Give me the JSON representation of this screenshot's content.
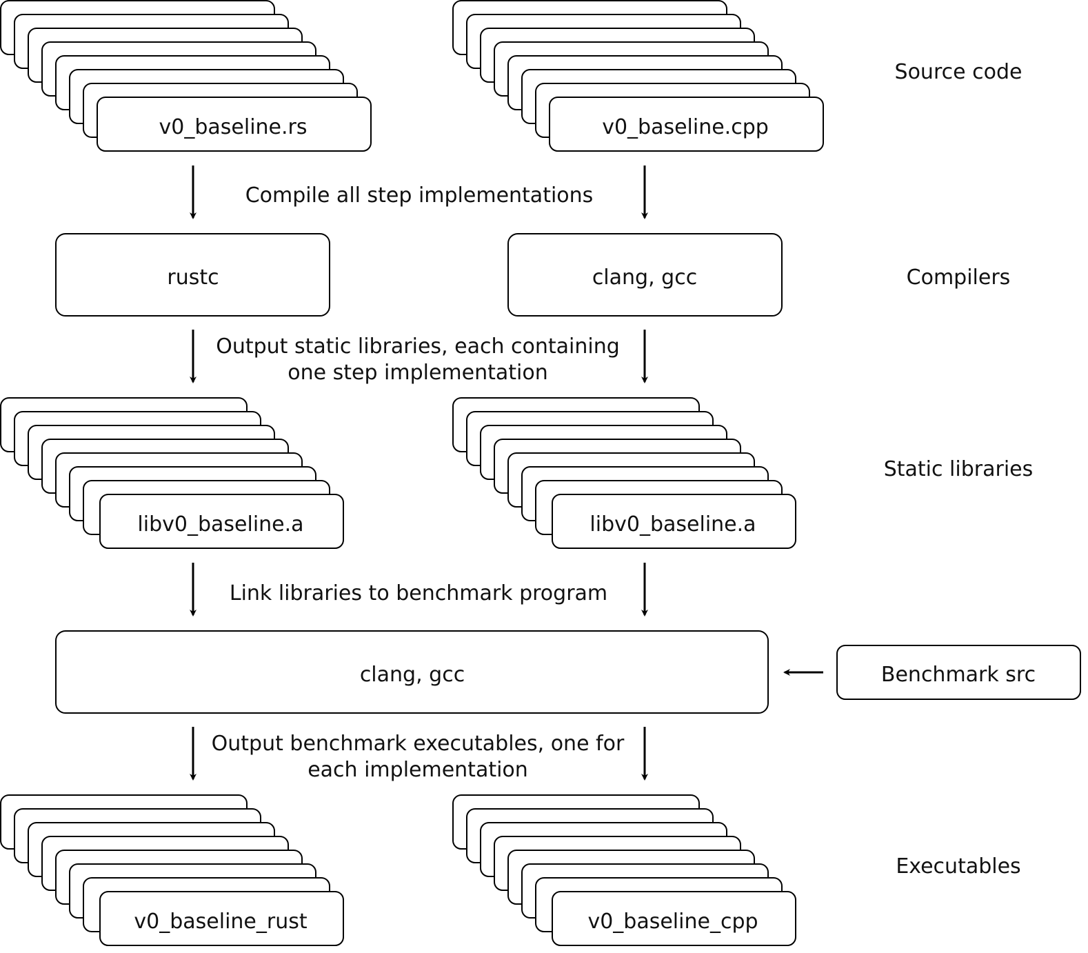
{
  "stages": {
    "source": "Source code",
    "compilers": "Compilers",
    "static_libs": "Static libraries",
    "executables": "Executables"
  },
  "rust": {
    "source_file": "v0_baseline.rs",
    "compiler": "rustc",
    "library": "libv0_baseline.a",
    "executable": "v0_baseline_rust"
  },
  "cpp": {
    "source_file": "v0_baseline.cpp",
    "compiler": "clang, gcc",
    "library": "libv0_baseline.a",
    "executable": "v0_baseline_cpp"
  },
  "linker": "clang, gcc",
  "benchmark_src": "Benchmark src",
  "steps": {
    "compile": "Compile all step implementations",
    "output_libs_1": "Output static libraries, each containing",
    "output_libs_2": "one step implementation",
    "link": "Link libraries to benchmark program",
    "output_exe_1": "Output benchmark executables, one for",
    "output_exe_2": "each implementation"
  }
}
